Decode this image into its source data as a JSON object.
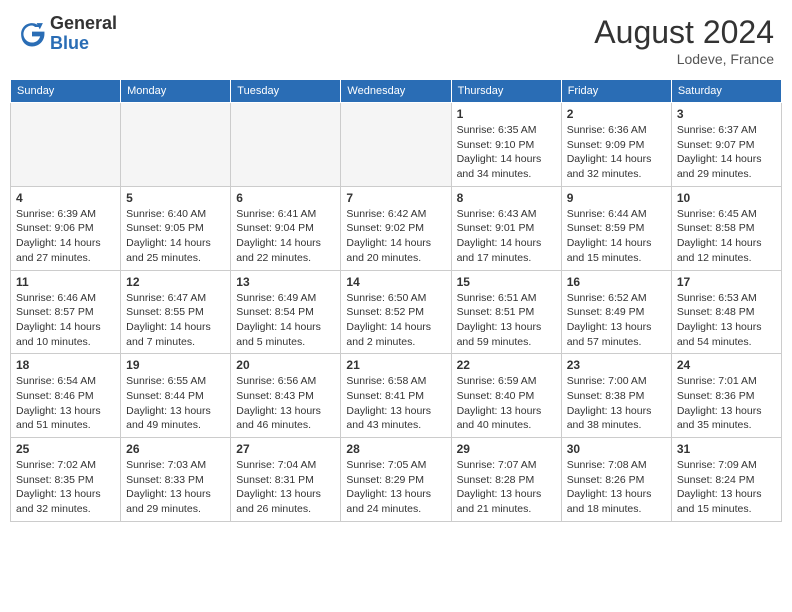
{
  "header": {
    "logo_general": "General",
    "logo_blue": "Blue",
    "month_title": "August 2024",
    "location": "Lodeve, France"
  },
  "weekdays": [
    "Sunday",
    "Monday",
    "Tuesday",
    "Wednesday",
    "Thursday",
    "Friday",
    "Saturday"
  ],
  "weeks": [
    [
      {
        "day": "",
        "info": ""
      },
      {
        "day": "",
        "info": ""
      },
      {
        "day": "",
        "info": ""
      },
      {
        "day": "",
        "info": ""
      },
      {
        "day": "1",
        "info": "Sunrise: 6:35 AM\nSunset: 9:10 PM\nDaylight: 14 hours\nand 34 minutes."
      },
      {
        "day": "2",
        "info": "Sunrise: 6:36 AM\nSunset: 9:09 PM\nDaylight: 14 hours\nand 32 minutes."
      },
      {
        "day": "3",
        "info": "Sunrise: 6:37 AM\nSunset: 9:07 PM\nDaylight: 14 hours\nand 29 minutes."
      }
    ],
    [
      {
        "day": "4",
        "info": "Sunrise: 6:39 AM\nSunset: 9:06 PM\nDaylight: 14 hours\nand 27 minutes."
      },
      {
        "day": "5",
        "info": "Sunrise: 6:40 AM\nSunset: 9:05 PM\nDaylight: 14 hours\nand 25 minutes."
      },
      {
        "day": "6",
        "info": "Sunrise: 6:41 AM\nSunset: 9:04 PM\nDaylight: 14 hours\nand 22 minutes."
      },
      {
        "day": "7",
        "info": "Sunrise: 6:42 AM\nSunset: 9:02 PM\nDaylight: 14 hours\nand 20 minutes."
      },
      {
        "day": "8",
        "info": "Sunrise: 6:43 AM\nSunset: 9:01 PM\nDaylight: 14 hours\nand 17 minutes."
      },
      {
        "day": "9",
        "info": "Sunrise: 6:44 AM\nSunset: 8:59 PM\nDaylight: 14 hours\nand 15 minutes."
      },
      {
        "day": "10",
        "info": "Sunrise: 6:45 AM\nSunset: 8:58 PM\nDaylight: 14 hours\nand 12 minutes."
      }
    ],
    [
      {
        "day": "11",
        "info": "Sunrise: 6:46 AM\nSunset: 8:57 PM\nDaylight: 14 hours\nand 10 minutes."
      },
      {
        "day": "12",
        "info": "Sunrise: 6:47 AM\nSunset: 8:55 PM\nDaylight: 14 hours\nand 7 minutes."
      },
      {
        "day": "13",
        "info": "Sunrise: 6:49 AM\nSunset: 8:54 PM\nDaylight: 14 hours\nand 5 minutes."
      },
      {
        "day": "14",
        "info": "Sunrise: 6:50 AM\nSunset: 8:52 PM\nDaylight: 14 hours\nand 2 minutes."
      },
      {
        "day": "15",
        "info": "Sunrise: 6:51 AM\nSunset: 8:51 PM\nDaylight: 13 hours\nand 59 minutes."
      },
      {
        "day": "16",
        "info": "Sunrise: 6:52 AM\nSunset: 8:49 PM\nDaylight: 13 hours\nand 57 minutes."
      },
      {
        "day": "17",
        "info": "Sunrise: 6:53 AM\nSunset: 8:48 PM\nDaylight: 13 hours\nand 54 minutes."
      }
    ],
    [
      {
        "day": "18",
        "info": "Sunrise: 6:54 AM\nSunset: 8:46 PM\nDaylight: 13 hours\nand 51 minutes."
      },
      {
        "day": "19",
        "info": "Sunrise: 6:55 AM\nSunset: 8:44 PM\nDaylight: 13 hours\nand 49 minutes."
      },
      {
        "day": "20",
        "info": "Sunrise: 6:56 AM\nSunset: 8:43 PM\nDaylight: 13 hours\nand 46 minutes."
      },
      {
        "day": "21",
        "info": "Sunrise: 6:58 AM\nSunset: 8:41 PM\nDaylight: 13 hours\nand 43 minutes."
      },
      {
        "day": "22",
        "info": "Sunrise: 6:59 AM\nSunset: 8:40 PM\nDaylight: 13 hours\nand 40 minutes."
      },
      {
        "day": "23",
        "info": "Sunrise: 7:00 AM\nSunset: 8:38 PM\nDaylight: 13 hours\nand 38 minutes."
      },
      {
        "day": "24",
        "info": "Sunrise: 7:01 AM\nSunset: 8:36 PM\nDaylight: 13 hours\nand 35 minutes."
      }
    ],
    [
      {
        "day": "25",
        "info": "Sunrise: 7:02 AM\nSunset: 8:35 PM\nDaylight: 13 hours\nand 32 minutes."
      },
      {
        "day": "26",
        "info": "Sunrise: 7:03 AM\nSunset: 8:33 PM\nDaylight: 13 hours\nand 29 minutes."
      },
      {
        "day": "27",
        "info": "Sunrise: 7:04 AM\nSunset: 8:31 PM\nDaylight: 13 hours\nand 26 minutes."
      },
      {
        "day": "28",
        "info": "Sunrise: 7:05 AM\nSunset: 8:29 PM\nDaylight: 13 hours\nand 24 minutes."
      },
      {
        "day": "29",
        "info": "Sunrise: 7:07 AM\nSunset: 8:28 PM\nDaylight: 13 hours\nand 21 minutes."
      },
      {
        "day": "30",
        "info": "Sunrise: 7:08 AM\nSunset: 8:26 PM\nDaylight: 13 hours\nand 18 minutes."
      },
      {
        "day": "31",
        "info": "Sunrise: 7:09 AM\nSunset: 8:24 PM\nDaylight: 13 hours\nand 15 minutes."
      }
    ]
  ]
}
